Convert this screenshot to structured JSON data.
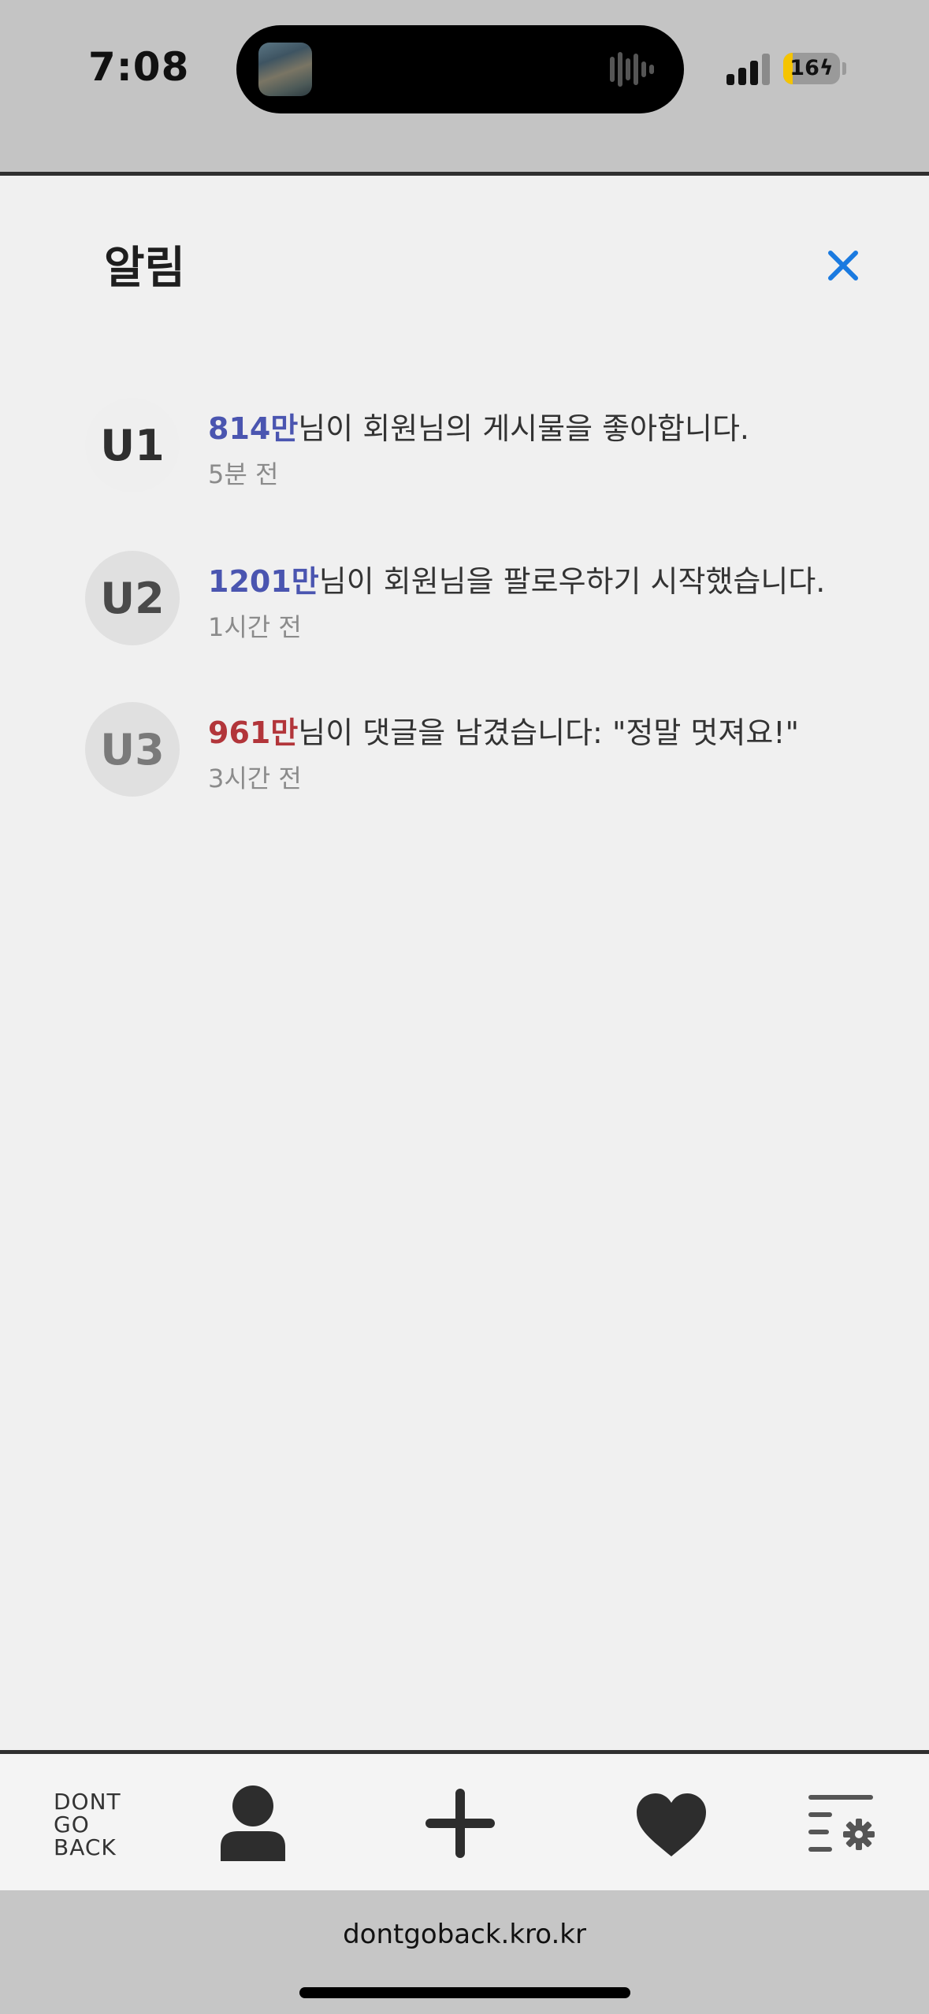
{
  "status_bar": {
    "time": "7:08",
    "battery": "16",
    "battery_level": 0.16
  },
  "panel": {
    "title": "알림",
    "close_icon": "close-icon"
  },
  "notifications": [
    {
      "avatar": "U1",
      "user": "814만",
      "user_color": "#4a55b0",
      "message": "님이 회원님의 게시물을 좋아합니다.",
      "time": "5분 전"
    },
    {
      "avatar": "U2",
      "user": "1201만",
      "user_color": "#4a55b0",
      "message": "님이 회원님을 팔로우하기 시작했습니다.",
      "time": "1시간 전"
    },
    {
      "avatar": "U3",
      "user": "961만",
      "user_color": "#b2353a",
      "message": "님이 댓글을 남겼습니다: \"정말 멋져요!\"",
      "time": "3시간 전"
    }
  ],
  "bottom_nav": {
    "logo_lines": [
      "DONT",
      "GO",
      "BACK"
    ],
    "items": [
      {
        "icon": "person-icon"
      },
      {
        "icon": "plus-icon"
      },
      {
        "icon": "heart-icon"
      },
      {
        "icon": "list-settings-icon"
      }
    ]
  },
  "browser": {
    "url": "dontgoback.kro.kr"
  },
  "colors": {
    "accent": "#1a7ae0",
    "panel_bg": "#f0f0f0",
    "chrome_bg": "#c6c6c6"
  }
}
